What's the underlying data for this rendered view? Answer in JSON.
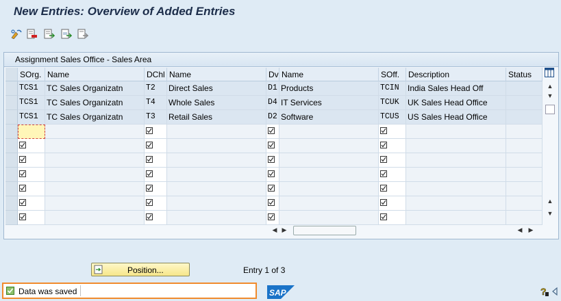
{
  "window": {
    "title": "New Entries: Overview of Added Entries"
  },
  "toolbar": {
    "buttons": [
      "display-change-icon",
      "delete-icon",
      "select-all-icon",
      "select-block-icon",
      "deselect-all-icon"
    ]
  },
  "table": {
    "title": "Assignment Sales Office - Sales Area",
    "columns": [
      "SOrg.",
      "Name",
      "DChl",
      "Name",
      "Dv",
      "Name",
      "SOff.",
      "Description",
      "Status"
    ],
    "rows": [
      [
        "TCS1",
        "TC Sales Organizatn",
        "T2",
        "Direct Sales",
        "D1",
        "Products",
        "TCIN",
        "India Sales Head Off",
        ""
      ],
      [
        "TCS1",
        "TC Sales Organizatn",
        "T4",
        "Whole Sales",
        "D4",
        "IT Services",
        "TCUK",
        "UK Sales Head Office",
        ""
      ],
      [
        "TCS1",
        "TC Sales Organizatn",
        "T3",
        "Retail Sales",
        "D2",
        "Software",
        "TCUS",
        "US Sales Head Office",
        ""
      ]
    ],
    "empty_rows": 7
  },
  "position_button": {
    "label": "Position..."
  },
  "entry_info": "Entry 1 of 3",
  "status": {
    "message": "Data was saved",
    "type": "success"
  },
  "branding": {
    "logo": "SAP"
  },
  "colors": {
    "status_border": "#f08a2c",
    "button_yellow": "#f6e68a",
    "title": "#1c2d4a"
  }
}
